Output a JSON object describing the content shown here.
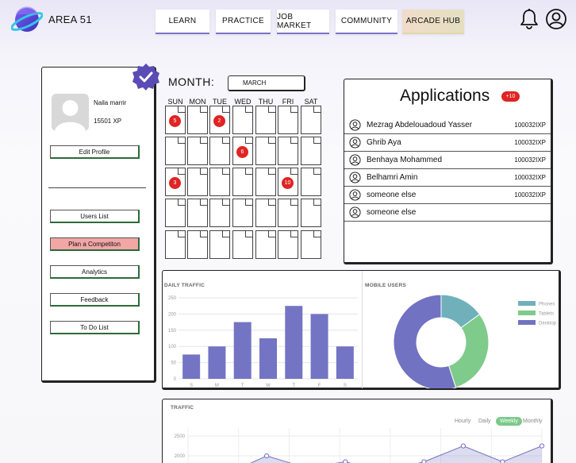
{
  "brand": {
    "name": "AREA 51"
  },
  "nav": {
    "items": [
      {
        "label": "LEARN"
      },
      {
        "label": "PRACTICE"
      },
      {
        "label": "JOB MARKET"
      },
      {
        "label": "COMMUNITY"
      },
      {
        "label": "ARCADE HUB"
      }
    ]
  },
  "profile": {
    "name": "Naila marrir",
    "xp": "15501 XP",
    "edit_label": "Edit Profile",
    "menu": [
      {
        "label": "Users List"
      },
      {
        "label": "Plan a Competiton"
      },
      {
        "label": "Analytics"
      },
      {
        "label": "Feedback"
      },
      {
        "label": "To Do List"
      }
    ]
  },
  "calendar": {
    "month_label": "MONTH:",
    "month_value": "MARCH",
    "days": [
      "SUN",
      "MON",
      "TUE",
      "WED",
      "THU",
      "FRI",
      "SAT"
    ],
    "badges": [
      {
        "row": 0,
        "col": 0,
        "value": "5"
      },
      {
        "row": 0,
        "col": 2,
        "value": "2"
      },
      {
        "row": 1,
        "col": 3,
        "value": "6"
      },
      {
        "row": 2,
        "col": 0,
        "value": "3"
      },
      {
        "row": 2,
        "col": 5,
        "value": "10"
      }
    ]
  },
  "applications": {
    "title": "Applications",
    "count": "+10",
    "rows": [
      {
        "name": "Mezrag Abdelouadoud Yasser",
        "id": "100032IXP"
      },
      {
        "name": "Ghrib Aya",
        "id": "100032IXP"
      },
      {
        "name": "Benhaya Mohammed",
        "id": "100032IXP"
      },
      {
        "name": "Belhamri Amin",
        "id": "100032IXP"
      },
      {
        "name": "someone else",
        "id": "100032IXP"
      },
      {
        "name": "someone else",
        "id": ""
      }
    ]
  },
  "chart_data": [
    {
      "type": "bar",
      "title": "DAILY TRAFFIC",
      "categories": [
        "S",
        "M",
        "T",
        "W",
        "T",
        "F",
        "S"
      ],
      "values": [
        75,
        100,
        175,
        125,
        225,
        200,
        100
      ],
      "ylim": [
        0,
        250
      ],
      "yticks": [
        "250",
        "200",
        "150",
        "100",
        "50",
        "0"
      ],
      "color": "#7474c4"
    },
    {
      "type": "pie",
      "title": "MOBILE USERS",
      "slices": [
        {
          "name": "Phones",
          "value": 15,
          "color": "#6fb0bb"
        },
        {
          "name": "Tablets",
          "value": 30,
          "color": "#7ecb8c"
        },
        {
          "name": "Desktop",
          "value": 55,
          "color": "#7272c2"
        }
      ],
      "legend": "right"
    },
    {
      "type": "area",
      "title": "TRAFFIC",
      "tabs": [
        "Hourly",
        "Daily",
        "Weekly",
        "Monthly"
      ],
      "active_tab": "Weekly",
      "yticks": [
        "2500",
        "2000"
      ],
      "values": [
        1700,
        1550,
        2000,
        1700,
        1850,
        1600,
        1850,
        2250,
        1850,
        2250
      ],
      "ylim": [
        1500,
        2700
      ],
      "color": "#7272c2"
    }
  ]
}
